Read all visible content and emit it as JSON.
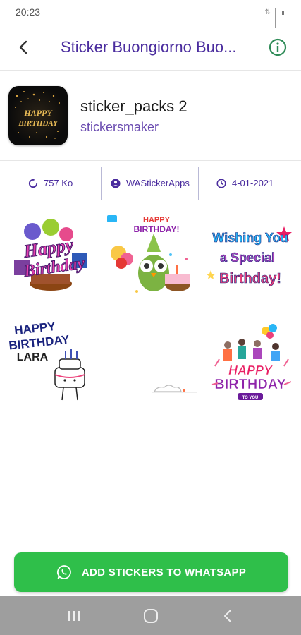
{
  "status": {
    "time": "20:23"
  },
  "toolbar": {
    "title": "Sticker Buongiorno Buo..."
  },
  "pack": {
    "thumb_text_1": "HAPPY",
    "thumb_text_2": "BIRTHDAY",
    "name": "sticker_packs 2",
    "author": "stickersmaker"
  },
  "meta": {
    "size": "757 Ko",
    "publisher": "WAStickerApps",
    "date": "4-01-2021"
  },
  "stickers": [
    {
      "lines": [
        "Happy",
        "Birthday"
      ]
    },
    {
      "lines": [
        "HAPPY",
        "BIRTHDAY!"
      ]
    },
    {
      "lines": [
        "Wishing You",
        "a Special",
        "Birthday!"
      ]
    },
    {
      "lines": [
        "HAPPY",
        "BIRTHDAY",
        "LARA"
      ]
    },
    {
      "lines": []
    },
    {
      "lines": [
        "HAPPY",
        "BIRTHDAY",
        "TO YOU"
      ]
    }
  ],
  "cta": {
    "label": "ADD STICKERS TO WHATSAPP"
  },
  "colors": {
    "primary": "#4a2c9e",
    "accent": "#2fbf4a",
    "nav": "#9e9e9e"
  }
}
